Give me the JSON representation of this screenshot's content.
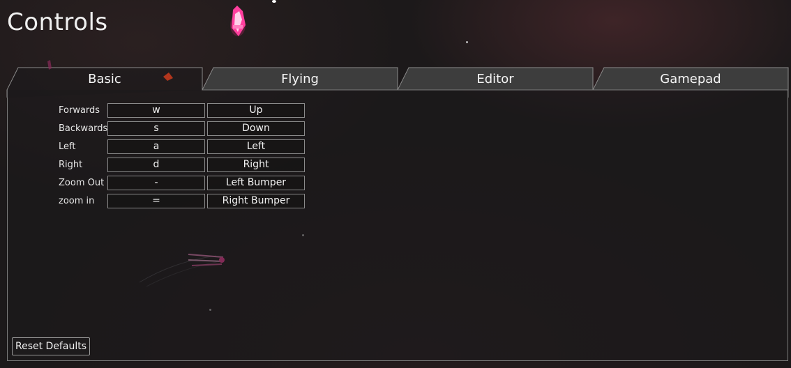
{
  "title": "Controls",
  "colors": {
    "tab_active_fill": "#1e1c1d",
    "tab_inactive_fill": "#3d3d3d",
    "border": "#7b7b7b",
    "accent_pink": "#ff4fa8"
  },
  "tabs": [
    {
      "label": "Basic",
      "active": true
    },
    {
      "label": "Flying",
      "active": false
    },
    {
      "label": "Editor",
      "active": false
    },
    {
      "label": "Gamepad",
      "active": false
    }
  ],
  "bindings": [
    {
      "action": "Forwards",
      "key": "w",
      "gamepad": "Up"
    },
    {
      "action": "Backwards",
      "key": "s",
      "gamepad": "Down"
    },
    {
      "action": "Left",
      "key": "a",
      "gamepad": "Left"
    },
    {
      "action": "Right",
      "key": "d",
      "gamepad": "Right"
    },
    {
      "action": "Zoom Out",
      "key": "-",
      "gamepad": "Left Bumper"
    },
    {
      "action": "zoom in",
      "key": "=",
      "gamepad": "Right Bumper"
    }
  ],
  "reset_label": "Reset Defaults"
}
